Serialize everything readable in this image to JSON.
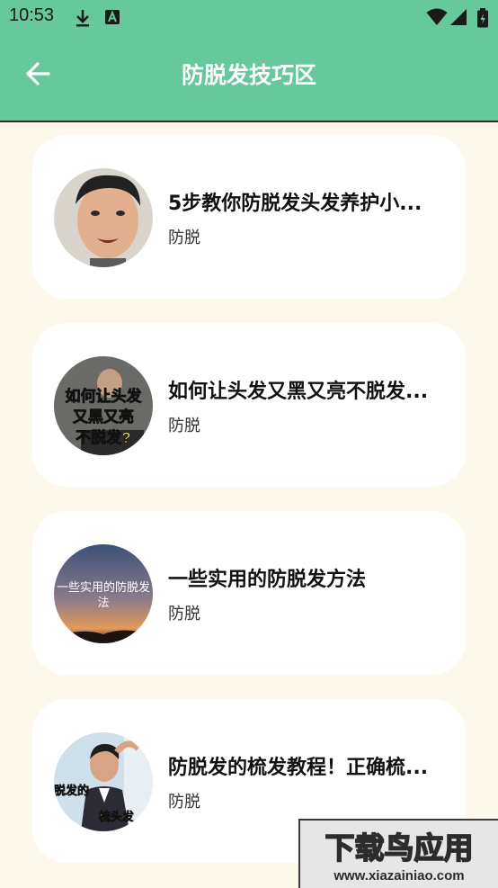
{
  "status_bar": {
    "time": "10:53"
  },
  "app_bar": {
    "title": "防脱发技巧区"
  },
  "cards": [
    {
      "title": "5步教你防脱发头发养护小...",
      "tag": "防脱"
    },
    {
      "title": "如何让头发又黑又亮不脱发...",
      "tag": "防脱",
      "thumb_text": [
        "如何让头发",
        "又黑又亮",
        "不脱发?"
      ]
    },
    {
      "title": "一些实用的防脱发方法",
      "tag": "防脱",
      "thumb_text": [
        "一些实用的防脱发",
        "法"
      ]
    },
    {
      "title": "防脱发的梳发教程！正确梳...",
      "tag": "防脱",
      "thumb_text": [
        "脱发的",
        "梳头发"
      ]
    }
  ],
  "watermark": {
    "logo": "下载鸟应用",
    "url": "www.xiazainiao.com"
  },
  "colors": {
    "accent": "#66c89b",
    "background": "#fdf8ec",
    "card": "#ffffff"
  }
}
